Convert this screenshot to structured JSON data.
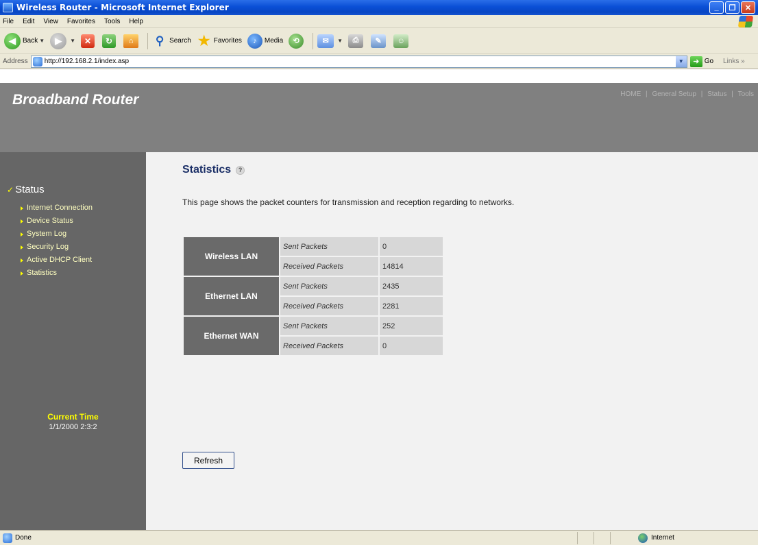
{
  "window": {
    "title": "Wireless Router - Microsoft Internet Explorer",
    "buttons": [
      "_",
      "❐",
      "✕"
    ]
  },
  "menu": [
    "File",
    "Edit",
    "View",
    "Favorites",
    "Tools",
    "Help"
  ],
  "toolbar": {
    "back_label": "Back",
    "search_label": "Search",
    "favorites_label": "Favorites",
    "media_label": "Media",
    "icons": [
      "back-icon",
      "forward-icon",
      "stop-icon",
      "refresh-icon",
      "home-icon",
      "search-icon",
      "favorites-icon",
      "media-icon",
      "history-icon",
      "mail-icon",
      "print-icon",
      "edit-icon",
      "messenger-icon"
    ]
  },
  "address": {
    "label": "Address",
    "url": "http://192.168.2.1/index.asp",
    "go_label": "Go",
    "links_label": "Links »"
  },
  "header": {
    "brand": "Broadband Router",
    "nav": [
      "HOME",
      "General Setup",
      "Status",
      "Tools"
    ],
    "separator": "|"
  },
  "sidebar": {
    "section": "Status",
    "items": [
      "Internet Connection",
      "Device Status",
      "System Log",
      "Security Log",
      "Active DHCP Client",
      "Statistics"
    ],
    "time_label": "Current Time",
    "time_value": "1/1/2000 2:3:2"
  },
  "main": {
    "title": "Statistics",
    "description": "This page shows the packet counters for transmission and reception regarding to networks.",
    "groups": [
      {
        "name": "Wireless LAN",
        "rows": [
          {
            "metric": "Sent Packets",
            "value": "0"
          },
          {
            "metric": "Received Packets",
            "value": "14814"
          }
        ]
      },
      {
        "name": "Ethernet LAN",
        "rows": [
          {
            "metric": "Sent Packets",
            "value": "2435"
          },
          {
            "metric": "Received Packets",
            "value": "2281"
          }
        ]
      },
      {
        "name": "Ethernet WAN",
        "rows": [
          {
            "metric": "Sent Packets",
            "value": "252"
          },
          {
            "metric": "Received Packets",
            "value": "0"
          }
        ]
      }
    ],
    "refresh_label": "Refresh"
  },
  "statusbar": {
    "status": "Done",
    "zone": "Internet"
  },
  "colors": {
    "header_gray": "#808080",
    "sidebar_gray": "#666666",
    "content_bg": "#f2f2f2",
    "sidebar_link": "#ffffc0",
    "time_label": "#ffff00",
    "title_blue": "#1a2e66"
  }
}
